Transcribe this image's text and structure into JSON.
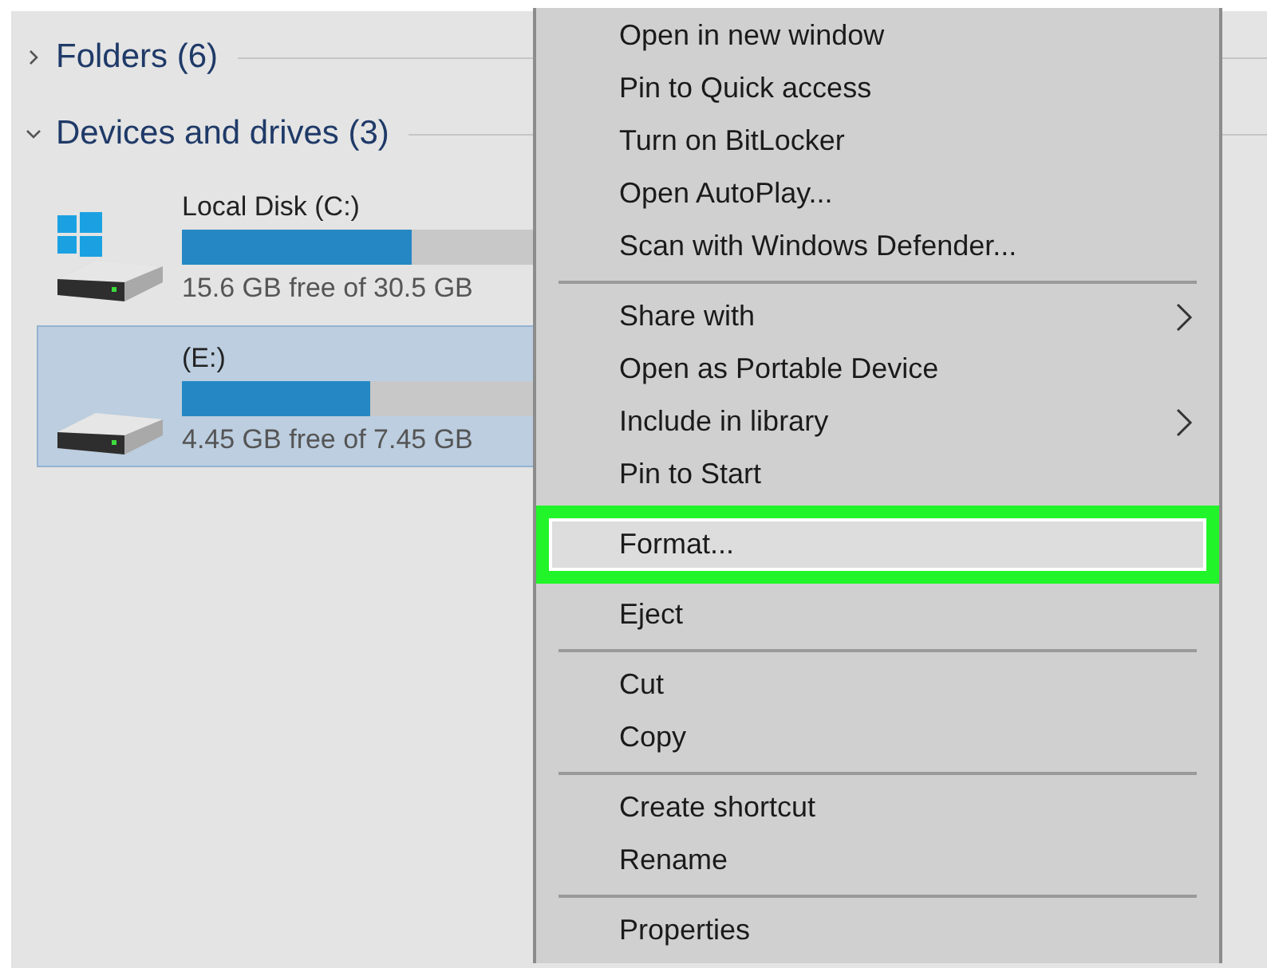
{
  "sections": [
    {
      "label": "Folders (6)",
      "expanded": false
    },
    {
      "label": "Devices and drives (3)",
      "expanded": true
    }
  ],
  "drives": [
    {
      "kind": "system",
      "name": "Local Disk (C:)",
      "level": 0.49,
      "free": "15.6 GB free of 30.5 GB",
      "selected": false
    },
    {
      "kind": "removable",
      "name": "(E:)",
      "level": 0.4,
      "free": "4.45 GB free of 7.45 GB",
      "selected": true
    }
  ],
  "context_menu": {
    "items": [
      {
        "kind": "item",
        "label": "Open in new window",
        "submenu": false,
        "highlighted": false
      },
      {
        "kind": "item",
        "label": "Pin to Quick access",
        "submenu": false,
        "highlighted": false
      },
      {
        "kind": "item",
        "label": "Turn on BitLocker",
        "submenu": false,
        "highlighted": false
      },
      {
        "kind": "item",
        "label": "Open AutoPlay...",
        "submenu": false,
        "highlighted": false
      },
      {
        "kind": "item",
        "label": "Scan with Windows Defender...",
        "submenu": false,
        "highlighted": false
      },
      {
        "kind": "separator"
      },
      {
        "kind": "item",
        "label": "Share with",
        "submenu": true,
        "highlighted": false
      },
      {
        "kind": "item",
        "label": "Open as Portable Device",
        "submenu": false,
        "highlighted": false
      },
      {
        "kind": "item",
        "label": "Include in library",
        "submenu": true,
        "highlighted": false
      },
      {
        "kind": "item",
        "label": "Pin to Start",
        "submenu": false,
        "highlighted": false
      },
      {
        "kind": "item",
        "label": "Format...",
        "submenu": false,
        "highlighted": true
      },
      {
        "kind": "item",
        "label": "Eject",
        "submenu": false,
        "highlighted": false
      },
      {
        "kind": "separator"
      },
      {
        "kind": "item",
        "label": "Cut",
        "submenu": false,
        "highlighted": false
      },
      {
        "kind": "item",
        "label": "Copy",
        "submenu": false,
        "highlighted": false
      },
      {
        "kind": "separator"
      },
      {
        "kind": "item",
        "label": "Create shortcut",
        "submenu": false,
        "highlighted": false
      },
      {
        "kind": "item",
        "label": "Rename",
        "submenu": false,
        "highlighted": false
      },
      {
        "kind": "separator"
      },
      {
        "kind": "item",
        "label": "Properties",
        "submenu": false,
        "highlighted": false
      }
    ]
  }
}
